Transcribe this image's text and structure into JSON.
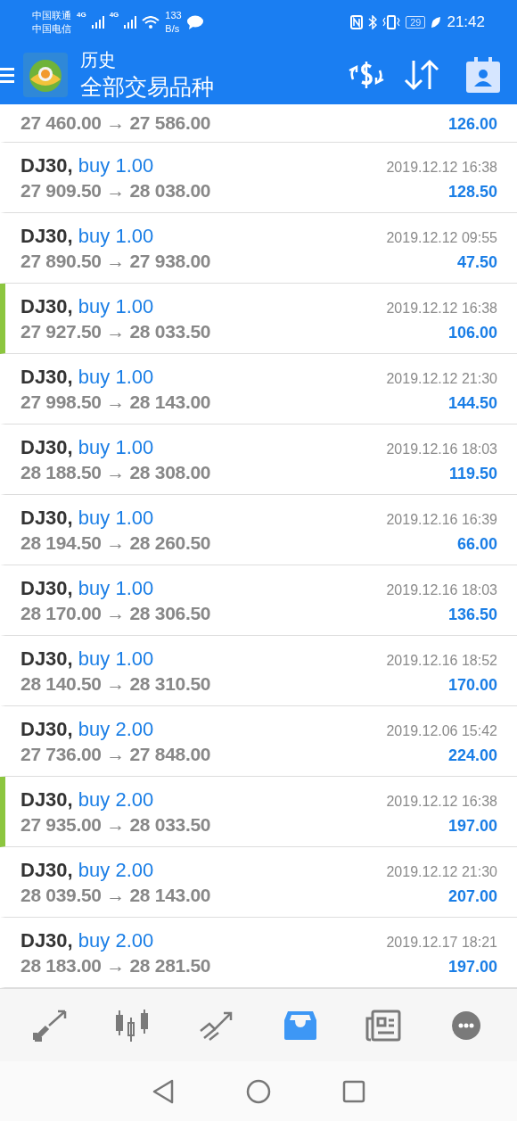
{
  "status_bar": {
    "carrier_1": "中国联通",
    "carrier_2": "中国电信",
    "network_1": "4G",
    "network_2": "4G",
    "speed_value": "133",
    "speed_unit": "B/s",
    "battery": "29",
    "time": "21:42"
  },
  "header": {
    "title": "历史",
    "subtitle": "全部交易品种"
  },
  "deals": [
    {
      "prices": "27 460.00 → 27 586.00",
      "profit": "126.00",
      "marked": false
    },
    {
      "symbol": "DJ30,",
      "side": "buy 1.00",
      "time": "2019.12.12 16:38",
      "prices": "27 909.50 → 28 038.00",
      "profit": "128.50",
      "marked": false
    },
    {
      "symbol": "DJ30,",
      "side": "buy 1.00",
      "time": "2019.12.12 09:55",
      "prices": "27 890.50 → 27 938.00",
      "profit": "47.50",
      "marked": false
    },
    {
      "symbol": "DJ30,",
      "side": "buy 1.00",
      "time": "2019.12.12 16:38",
      "prices": "27 927.50 → 28 033.50",
      "profit": "106.00",
      "marked": true
    },
    {
      "symbol": "DJ30,",
      "side": "buy 1.00",
      "time": "2019.12.12 21:30",
      "prices": "27 998.50 → 28 143.00",
      "profit": "144.50",
      "marked": false
    },
    {
      "symbol": "DJ30,",
      "side": "buy 1.00",
      "time": "2019.12.16 18:03",
      "prices": "28 188.50 → 28 308.00",
      "profit": "119.50",
      "marked": false
    },
    {
      "symbol": "DJ30,",
      "side": "buy 1.00",
      "time": "2019.12.16 16:39",
      "prices": "28 194.50 → 28 260.50",
      "profit": "66.00",
      "marked": false
    },
    {
      "symbol": "DJ30,",
      "side": "buy 1.00",
      "time": "2019.12.16 18:03",
      "prices": "28 170.00 → 28 306.50",
      "profit": "136.50",
      "marked": false
    },
    {
      "symbol": "DJ30,",
      "side": "buy 1.00",
      "time": "2019.12.16 18:52",
      "prices": "28 140.50 → 28 310.50",
      "profit": "170.00",
      "marked": false
    },
    {
      "symbol": "DJ30,",
      "side": "buy 2.00",
      "time": "2019.12.06 15:42",
      "prices": "27 736.00 → 27 848.00",
      "profit": "224.00",
      "marked": false
    },
    {
      "symbol": "DJ30,",
      "side": "buy 2.00",
      "time": "2019.12.12 16:38",
      "prices": "27 935.00 → 28 033.50",
      "profit": "197.00",
      "marked": true
    },
    {
      "symbol": "DJ30,",
      "side": "buy 2.00",
      "time": "2019.12.12 21:30",
      "prices": "28 039.50 → 28 143.00",
      "profit": "207.00",
      "marked": false
    },
    {
      "symbol": "DJ30,",
      "side": "buy 2.00",
      "time": "2019.12.17 18:21",
      "prices": "28 183.00 → 28 281.50",
      "profit": "197.00",
      "marked": false
    }
  ],
  "bottom_nav": [
    {
      "selected": false
    },
    {
      "selected": false
    },
    {
      "selected": false
    },
    {
      "selected": true
    },
    {
      "selected": false
    },
    {
      "selected": false
    }
  ]
}
